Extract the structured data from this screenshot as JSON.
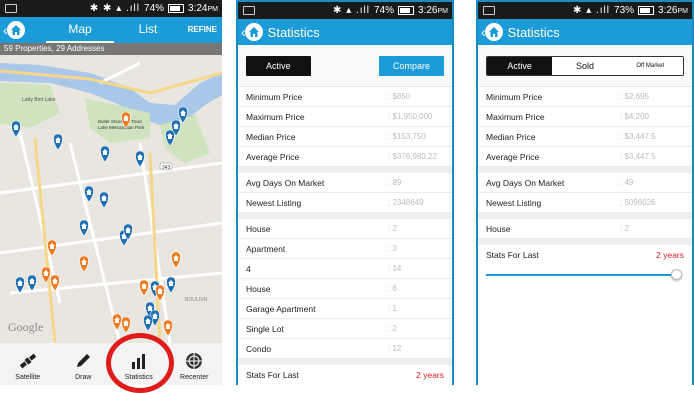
{
  "phone1": {
    "status": {
      "time": "3:24",
      "ampm": "PM",
      "battery": "74%"
    },
    "tabs": [
      "Map",
      "List"
    ],
    "refine": "REFINE",
    "summary": "59 Properties, 29 Addresses",
    "map_labels": [
      "Lady Bird Lake",
      "Butler Shores at Town Lake Metropolitan Park",
      "BOULDIN",
      "343"
    ],
    "google": "Google",
    "nav": [
      {
        "label": "Satellite",
        "icon": "satellite-icon"
      },
      {
        "label": "Draw",
        "icon": "pencil-icon"
      },
      {
        "label": "Statistics",
        "icon": "bar-chart-icon"
      },
      {
        "label": "Recenter",
        "icon": "recenter-icon"
      }
    ],
    "highlight_color": "#e01b1b"
  },
  "phone2": {
    "status": {
      "time": "3:26",
      "ampm": "PM",
      "battery": "74%"
    },
    "title": "Statistics",
    "active_label": "Active",
    "compare_label": "Compare",
    "group1": [
      {
        "label": "Minimum Price",
        "value": ": $850"
      },
      {
        "label": "Maximum Price",
        "value": ": $1,950,000"
      },
      {
        "label": "Median Price",
        "value": ": $153,750"
      },
      {
        "label": "Average Price",
        "value": ": $376,980.22"
      }
    ],
    "group2": [
      {
        "label": "Avg Days On Market",
        "value": ": 89"
      },
      {
        "label": "Newest Listing",
        "value": ": 2348649"
      }
    ],
    "group3": [
      {
        "label": "House",
        "value": ": 2"
      },
      {
        "label": "Apartment",
        "value": ": 3"
      },
      {
        "label": "4",
        "value": ": 14"
      },
      {
        "label": "House",
        "value": ": 6"
      },
      {
        "label": "Garage Apartment",
        "value": ": 1"
      },
      {
        "label": "Single Lot",
        "value": ": 2"
      },
      {
        "label": "Condo",
        "value": ": 12"
      }
    ],
    "stats_for_label": "Stats For Last",
    "stats_for_value": "2 years"
  },
  "phone3": {
    "status": {
      "time": "3:26",
      "ampm": "PM",
      "battery": "73%"
    },
    "title": "Statistics",
    "segments": [
      "Active",
      "Sold",
      "Off Market"
    ],
    "group1": [
      {
        "label": "Minimum Price",
        "value": ": $2,695"
      },
      {
        "label": "Maximum Price",
        "value": ": $4,200"
      },
      {
        "label": "Median Price",
        "value": ": $3,447.5"
      },
      {
        "label": "Average Price",
        "value": ": $3,447.5"
      }
    ],
    "group2": [
      {
        "label": "Avg Days On Market",
        "value": ": 49"
      },
      {
        "label": "Newest Listing",
        "value": ": 5096026"
      }
    ],
    "group3": [
      {
        "label": "House",
        "value": ": 2"
      }
    ],
    "stats_for_label": "Stats For Last",
    "stats_for_value": "2 years",
    "slider_fraction": 1.0
  },
  "colors": {
    "accent": "#1b9cd8",
    "highlight": "#e01b1b",
    "years": "#dd2222"
  }
}
